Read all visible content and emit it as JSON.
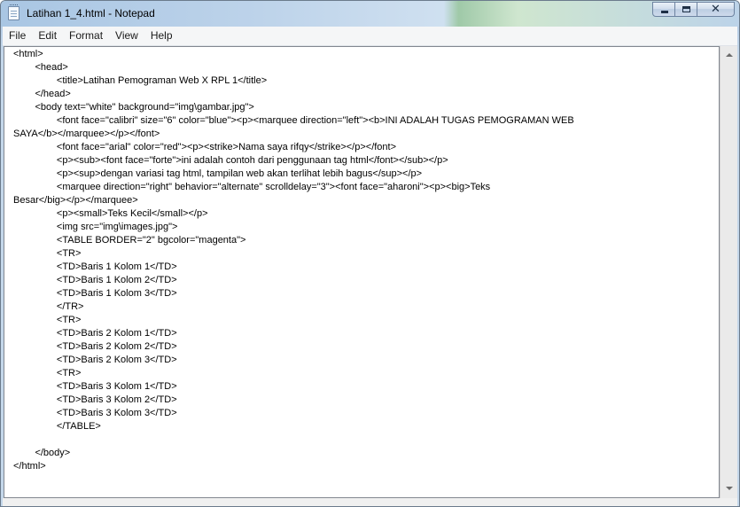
{
  "window": {
    "title": "Latihan 1_4.html - Notepad"
  },
  "icons": {
    "app": "notepad-icon",
    "minimize": "minimize-icon",
    "maximize": "maximize-icon",
    "close": "close-icon"
  },
  "caption": {
    "close_glyph": "✕"
  },
  "menu": [
    {
      "label": "File"
    },
    {
      "label": "Edit"
    },
    {
      "label": "Format"
    },
    {
      "label": "View"
    },
    {
      "label": "Help"
    }
  ],
  "editor": {
    "lines": [
      "<html>",
      "\t<head>",
      "\t\t<title>Latihan Pemograman Web X RPL 1</title>",
      "\t</head>",
      "\t<body text=\"white\" background=\"img\\gambar.jpg\">",
      "\t\t<font face=\"calibri\" size=\"6\" color=\"blue\"><p><marquee direction=\"left\"><b>INI ADALAH TUGAS PEMOGRAMAN WEB",
      "SAYA</b></marquee></p></font>",
      "\t\t<font face=\"arial\" color=\"red\"><p><strike>Nama saya rifqy</strike></p></font>",
      "\t\t<p><sub><font face=\"forte\">ini adalah contoh dari penggunaan tag html</font></sub></p>",
      "\t\t<p><sup>dengan variasi tag html, tampilan web akan terlihat lebih bagus</sup></p>",
      "\t\t<marquee direction=\"right\" behavior=\"alternate\" scrolldelay=\"3\"><font face=\"aharoni\"><p><big>Teks",
      "Besar</big></p></marquee>",
      "\t\t<p><small>Teks Kecil</small></p>",
      "\t\t<img src=\"img\\images.jpg\">",
      "\t\t<TABLE BORDER=\"2\" bgcolor=\"magenta\">",
      "\t\t<TR>",
      "\t\t<TD>Baris 1 Kolom 1</TD>",
      "\t\t<TD>Baris 1 Kolom 2</TD>",
      "\t\t<TD>Baris 1 Kolom 3</TD>",
      "\t\t</TR>",
      "\t\t<TR>",
      "\t\t<TD>Baris 2 Kolom 1</TD>",
      "\t\t<TD>Baris 2 Kolom 2</TD>",
      "\t\t<TD>Baris 2 Kolom 3</TD>",
      "\t\t<TR>",
      "\t\t<TD>Baris 3 Kolom 1</TD>",
      "\t\t<TD>Baris 3 Kolom 2</TD>",
      "\t\t<TD>Baris 3 Kolom 3</TD>",
      "\t\t</TABLE>",
      "",
      "\t</body>",
      "</html>"
    ]
  }
}
